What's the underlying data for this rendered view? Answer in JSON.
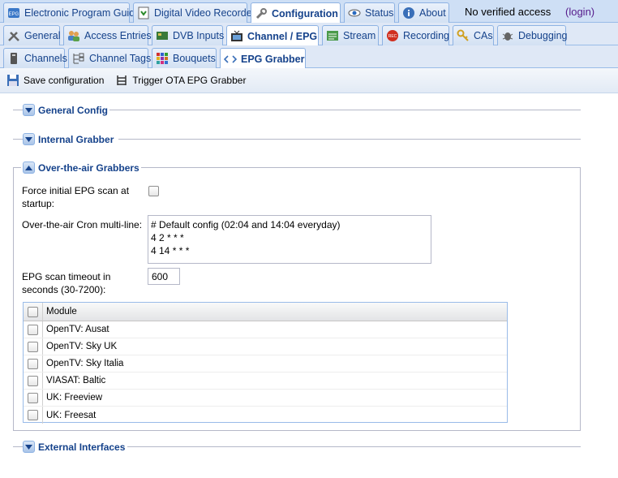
{
  "tabs_row1": [
    {
      "label": "Electronic Program Guide",
      "icon": "epg-icon"
    },
    {
      "label": "Digital Video Recorder",
      "icon": "dvr-icon"
    },
    {
      "label": "Configuration",
      "icon": "wrench-icon",
      "active": true
    },
    {
      "label": "Status",
      "icon": "eye-icon"
    },
    {
      "label": "About",
      "icon": "info-icon"
    }
  ],
  "access": {
    "status": "No verified access",
    "login": "(login)"
  },
  "tabs_row2": [
    {
      "label": "General",
      "icon": "tools-icon"
    },
    {
      "label": "Access Entries",
      "icon": "users-icon"
    },
    {
      "label": "DVB Inputs",
      "icon": "card-icon"
    },
    {
      "label": "Channel / EPG",
      "icon": "tv-icon",
      "active": true
    },
    {
      "label": "Stream",
      "icon": "stream-icon"
    },
    {
      "label": "Recording",
      "icon": "rec-icon"
    },
    {
      "label": "CAs",
      "icon": "key-icon"
    },
    {
      "label": "Debugging",
      "icon": "bug-icon"
    }
  ],
  "tabs_row3": [
    {
      "label": "Channels",
      "icon": "channels-icon"
    },
    {
      "label": "Channel Tags",
      "icon": "tags-icon"
    },
    {
      "label": "Bouquets",
      "icon": "bouquets-icon"
    },
    {
      "label": "EPG Grabber",
      "icon": "code-icon",
      "active": true
    }
  ],
  "toolbar": {
    "save": "Save configuration",
    "trigger": "Trigger OTA EPG Grabber"
  },
  "sections": {
    "general": "General Config",
    "internal": "Internal Grabber",
    "ota": "Over-the-air Grabbers",
    "external": "External Interfaces"
  },
  "ota": {
    "force_label_1": "Force initial EPG scan at",
    "force_label_2": "startup:",
    "force_checked": false,
    "cron_label": "Over-the-air Cron multi-line:",
    "cron_value": "# Default config (02:04 and 14:04 everyday)\n4 2 * * *\n4 14 * * *",
    "timeout_label_1": "EPG scan timeout in",
    "timeout_label_2": "seconds (30-7200):",
    "timeout_value": "600"
  },
  "grid": {
    "header": "Module",
    "rows": [
      "OpenTV: Ausat",
      "OpenTV: Sky UK",
      "OpenTV: Sky Italia",
      "VIASAT: Baltic",
      "UK: Freeview",
      "UK: Freesat"
    ]
  }
}
